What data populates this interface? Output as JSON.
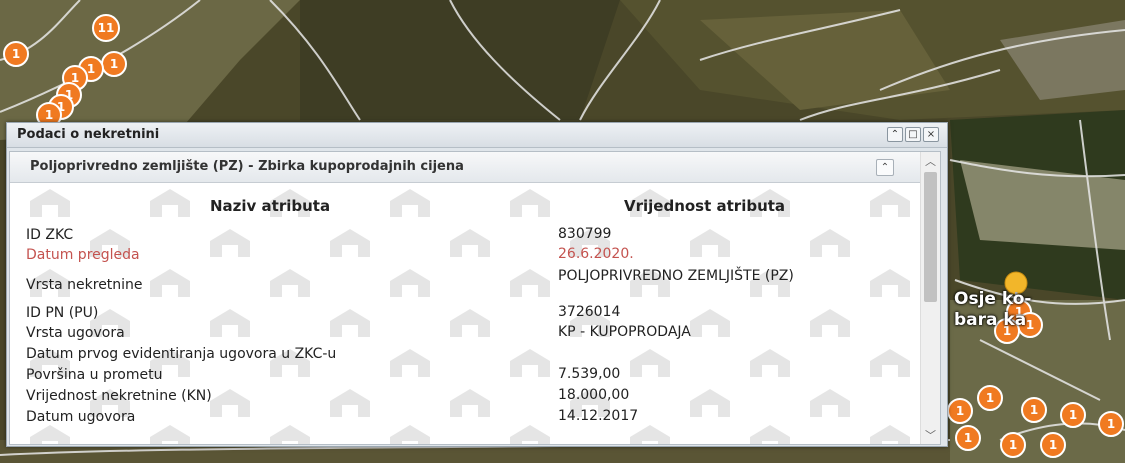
{
  "colors": {
    "highlight": "#c4534f",
    "marker": "#f07a21"
  },
  "map": {
    "place_label_line1": "Osje ko-",
    "place_label_line2": "bara ka",
    "marker_labels": [
      "1",
      "11",
      "1",
      "1",
      "1",
      "1",
      "1",
      "1",
      "1",
      "1",
      "1",
      "1",
      "1",
      "1",
      "1",
      "1",
      "1",
      "1",
      "1"
    ]
  },
  "popup": {
    "title": "Podaci o nekretnini",
    "buttons": {
      "collapse": "⌃",
      "maximize": "□",
      "close": "×"
    },
    "panel": {
      "title": "Poljoprivredno zemljište (PZ) - Zbirka kupoprodajnih cijena",
      "collapse_icon": "⌃",
      "headers": {
        "name": "Naziv atributa",
        "value": "Vrijednost atributa"
      },
      "rows": [
        {
          "name": "ID ZKC",
          "value": "830799"
        },
        {
          "name": "Datum pregleda",
          "value": "26.6.2020."
        },
        {
          "name": "Vrsta nekretnine",
          "value": "POLJOPRIVREDNO ZEMLJIŠTE (PZ)"
        },
        {
          "name": "ID PN (PU)",
          "value": "3726014"
        },
        {
          "name": "Vrsta ugovora",
          "value": "KP - KUPOPRODAJA"
        },
        {
          "name": "Datum prvog evidentiranja ugovora u ZKC-u",
          "value": ""
        },
        {
          "name": "Površina u prometu",
          "value": "7.539,00"
        },
        {
          "name": "Vrijednost nekretnine (KN)",
          "value": "18.000,00"
        },
        {
          "name": "Datum ugovora",
          "value": "14.12.2017"
        }
      ]
    }
  }
}
